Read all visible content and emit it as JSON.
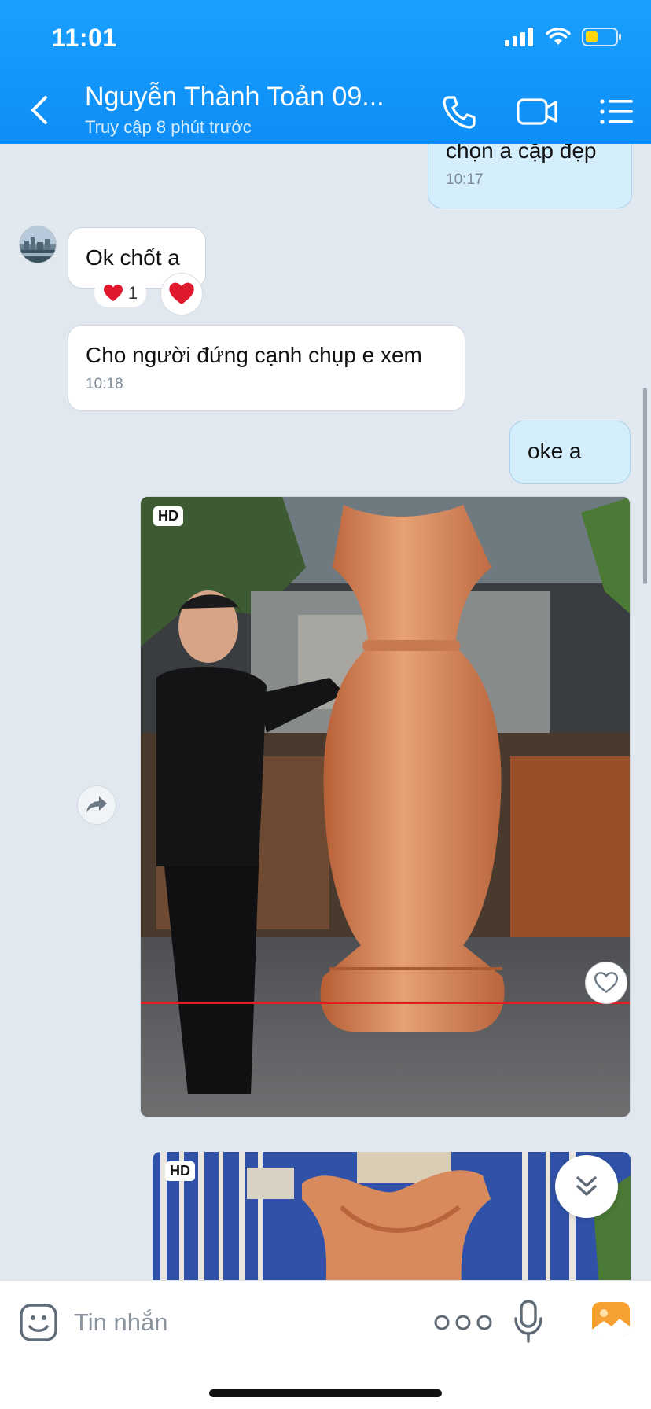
{
  "status_bar": {
    "time": "11:01"
  },
  "header": {
    "contact_name": "Nguyễn Thành Toản 09...",
    "last_seen": "Truy cập 8 phút trước",
    "back_icon": "chevron-left-icon",
    "call_icon": "phone-icon",
    "video_icon": "video-camera-icon",
    "menu_icon": "list-icon"
  },
  "messages": [
    {
      "id": "m1",
      "direction": "out",
      "text": "chọn a cặp đẹp",
      "time": "10:17"
    },
    {
      "id": "m2",
      "direction": "in",
      "text": "Ok chốt a",
      "reaction": {
        "emoji": "❤",
        "count": "1"
      }
    },
    {
      "id": "m3",
      "direction": "in",
      "text": "Cho người đứng cạnh chụp e xem",
      "time": "10:18"
    },
    {
      "id": "m4",
      "direction": "out",
      "text": "oke a"
    },
    {
      "id": "m5",
      "direction": "in",
      "type": "video",
      "badge": "HD"
    },
    {
      "id": "m6",
      "direction": "in",
      "type": "video",
      "badge": "HD"
    }
  ],
  "composer": {
    "placeholder": "Tin nhắn",
    "emoji_icon": "sticker-face-icon",
    "more_icon": "more-dots-icon",
    "mic_icon": "microphone-icon",
    "image_icon": "image-gallery-icon"
  },
  "colors": {
    "header_blue": "#0d8ef7",
    "outgoing_bubble": "#d4eefc",
    "incoming_bubble": "#ffffff",
    "chat_background": "#e2e8f0",
    "heart_red": "#e0182d",
    "image_button_orange": "#f7a032"
  }
}
